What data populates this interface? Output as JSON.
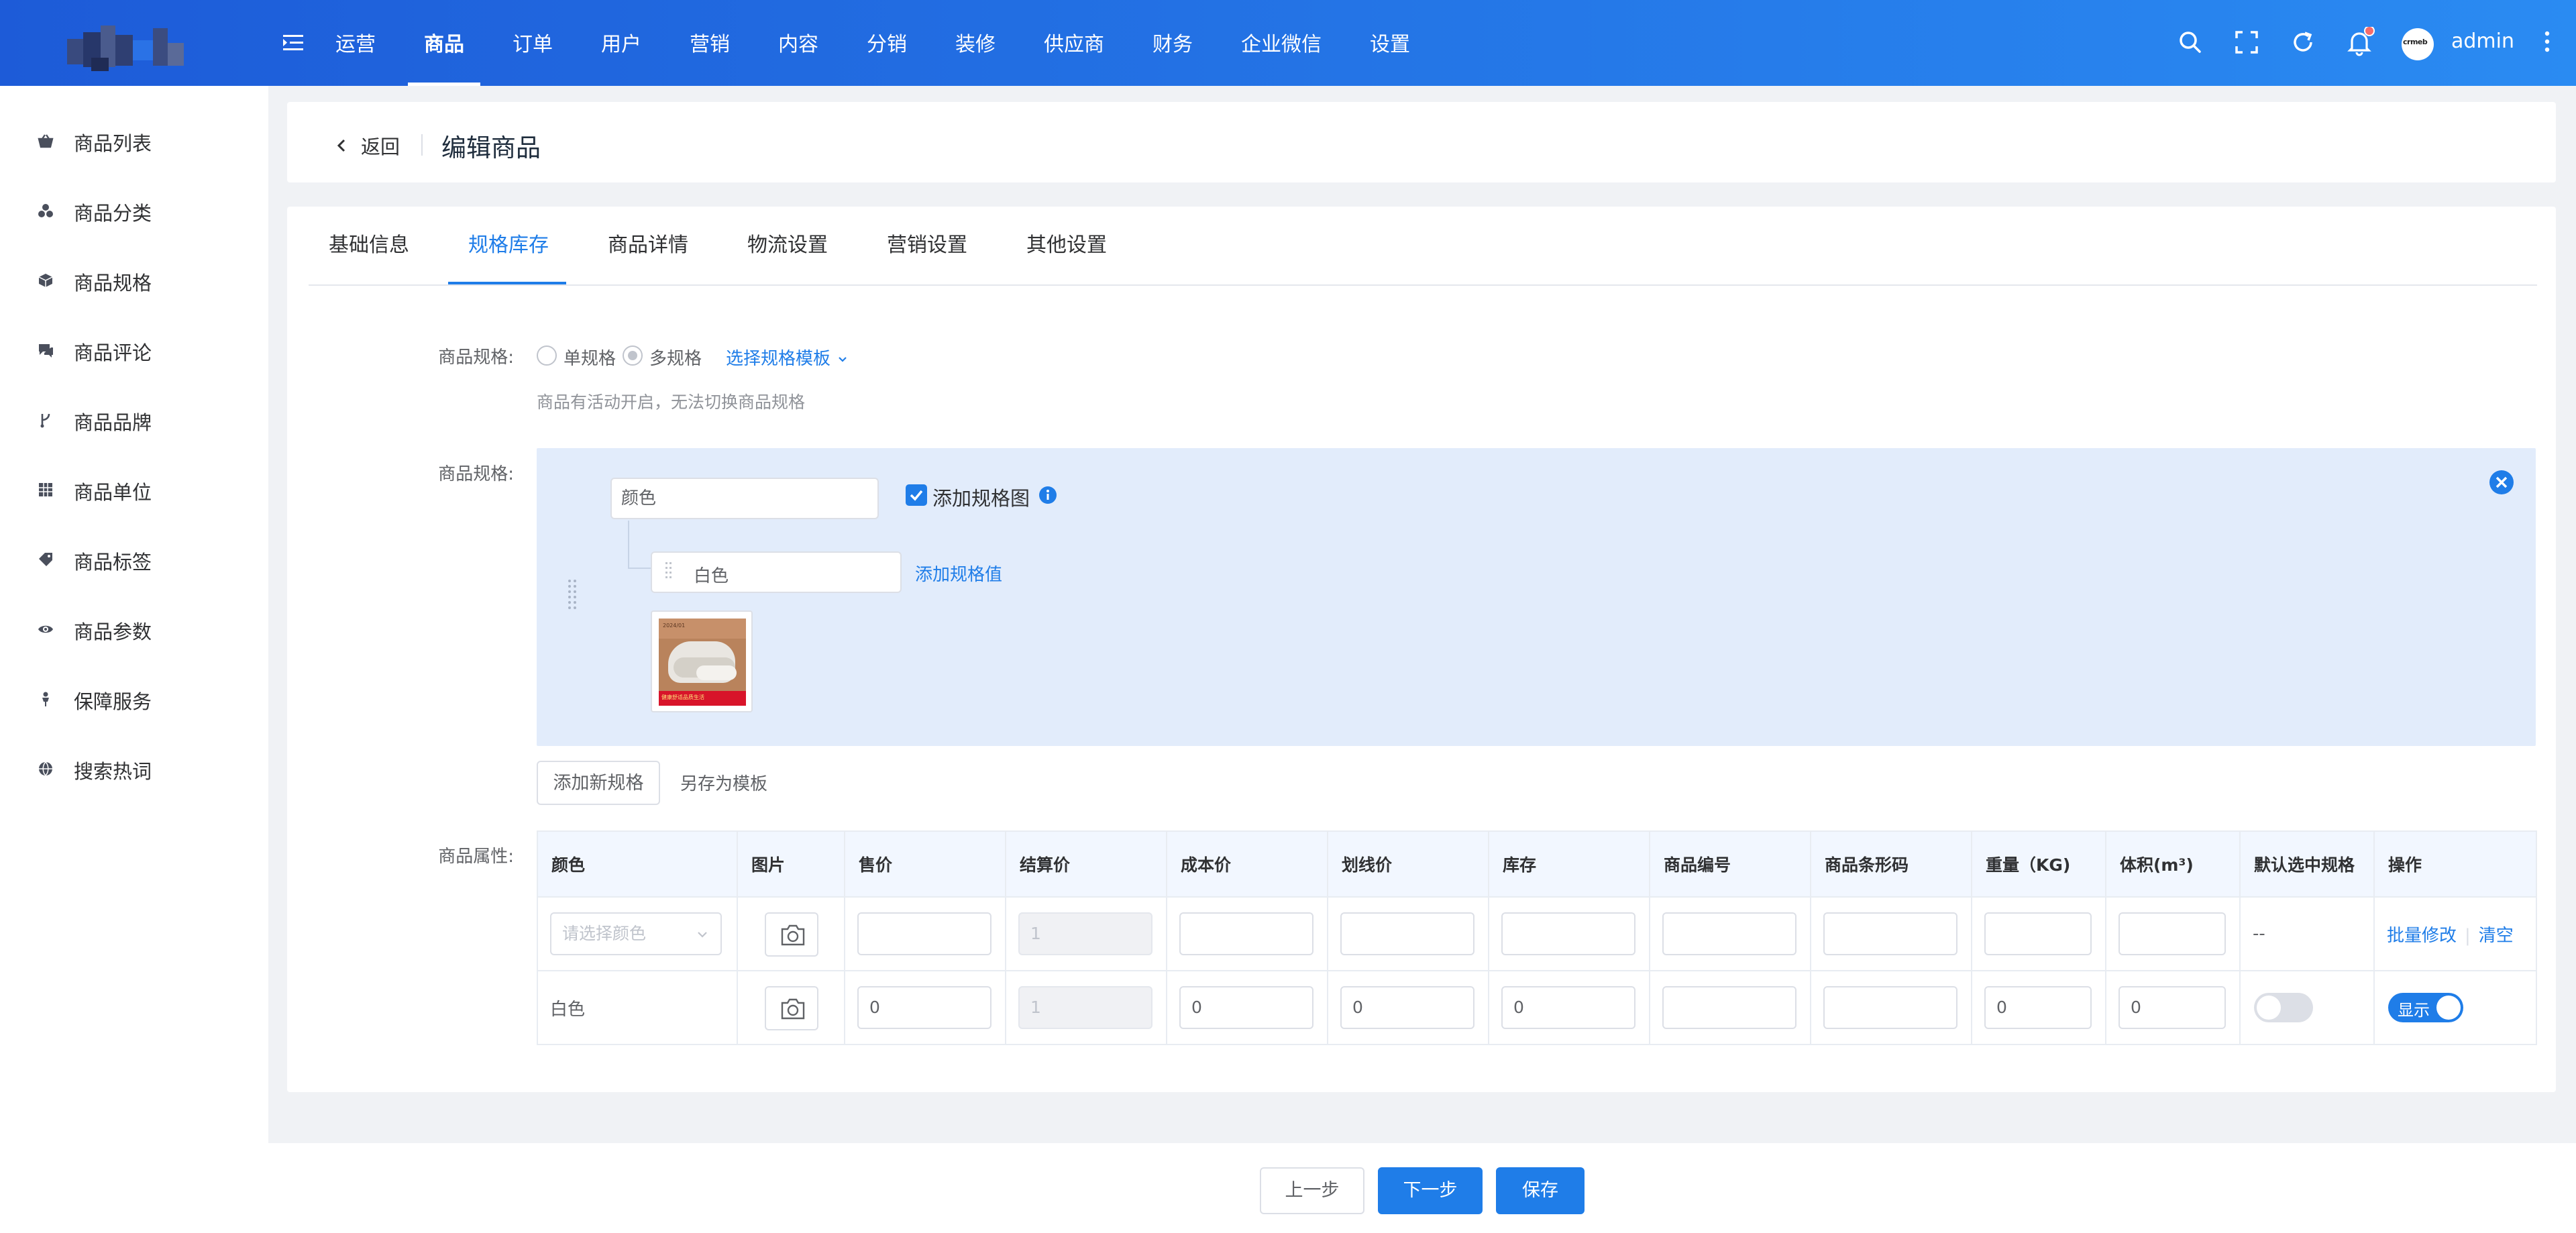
{
  "topbar": {
    "nav": [
      "运营",
      "商品",
      "订单",
      "用户",
      "营销",
      "内容",
      "分销",
      "装修",
      "供应商",
      "财务",
      "企业微信",
      "设置"
    ],
    "active_nav": "商品",
    "admin_name": "admin",
    "avatar_text": "crmeb",
    "icons": [
      "search-icon",
      "fullscreen-icon",
      "refresh-icon",
      "bell-icon",
      "more-vertical-icon"
    ],
    "colors": {
      "start": "#1d5bd8",
      "end": "#2a8bf2",
      "badge": "#f56c6c"
    }
  },
  "sidebar": {
    "items": [
      {
        "label": "商品列表",
        "icon": "basket-icon"
      },
      {
        "label": "商品分类",
        "icon": "category-icon"
      },
      {
        "label": "商品规格",
        "icon": "cube-icon"
      },
      {
        "label": "商品评论",
        "icon": "comment-icon"
      },
      {
        "label": "商品品牌",
        "icon": "brand-icon"
      },
      {
        "label": "商品单位",
        "icon": "grid-icon"
      },
      {
        "label": "商品标签",
        "icon": "tag-icon"
      },
      {
        "label": "商品参数",
        "icon": "eye-icon"
      },
      {
        "label": "保障服务",
        "icon": "service-icon"
      },
      {
        "label": "搜索热词",
        "icon": "globe-icon"
      }
    ]
  },
  "header": {
    "back_label": "返回",
    "title": "编辑商品"
  },
  "tabs": [
    "基础信息",
    "规格库存",
    "商品详情",
    "物流设置",
    "营销设置",
    "其他设置"
  ],
  "active_tab": "规格库存",
  "spec_type": {
    "label": "商品规格:",
    "option_single": "单规格",
    "option_multi": "多规格",
    "selected": "多规格",
    "template_link": "选择规格模板",
    "tip": "商品有活动开启，无法切换商品规格"
  },
  "spec": {
    "label": "商品规格:",
    "name_value": "颜色",
    "add_image_label": "添加规格图",
    "add_image_checked": true,
    "value_item": "白色",
    "add_value_link": "添加规格值",
    "image_badge_top": "2024/01",
    "image_badge_bottom": "健康舒适品质生活"
  },
  "spec_actions": {
    "add_spec": "添加新规格",
    "save_template": "另存为模板"
  },
  "attr": {
    "label": "商品属性:",
    "headers": [
      "颜色",
      "图片",
      "售价",
      "结算价",
      "成本价",
      "划线价",
      "库存",
      "商品编号",
      "商品条形码",
      "重量（KG)",
      "体积(m³)",
      "默认选中规格",
      "操作"
    ],
    "batch_row": {
      "select_placeholder": "请选择颜色",
      "settle_price": "1",
      "default_col": "--",
      "action_batch": "批量修改",
      "action_clear": "清空"
    },
    "rows": [
      {
        "color": "白色",
        "price": "0",
        "settle": "1",
        "cost": "0",
        "original": "0",
        "stock": "0",
        "code": "",
        "barcode": "",
        "weight": "0",
        "volume": "0",
        "default_on": false,
        "show_label": "显示",
        "show_on": true
      }
    ]
  },
  "footer": {
    "prev": "上一步",
    "next": "下一步",
    "save": "保存"
  }
}
